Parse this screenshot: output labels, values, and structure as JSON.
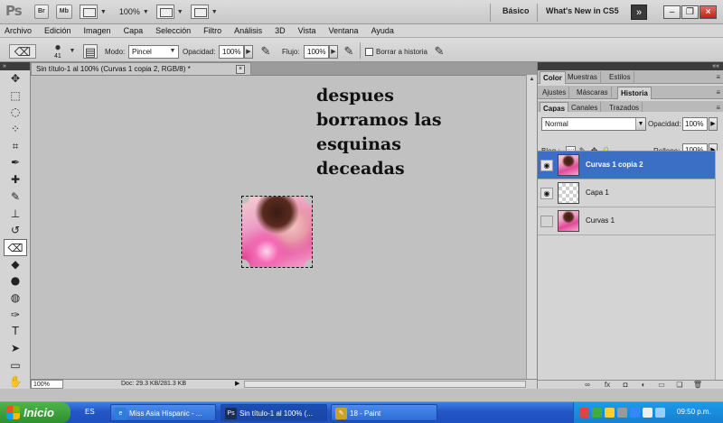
{
  "appbar": {
    "zoom": "100%",
    "workspace_basic": "Básico",
    "whats_new": "What's New in CS5",
    "bridge_label": "Br",
    "minibridge_label": "Mb"
  },
  "menu": [
    "Archivo",
    "Edición",
    "Imagen",
    "Capa",
    "Selección",
    "Filtro",
    "Análisis",
    "3D",
    "Vista",
    "Ventana",
    "Ayuda"
  ],
  "options": {
    "brush_size": "41",
    "mode_label": "Modo:",
    "mode_value": "Pincel",
    "opacity_label": "Opacidad:",
    "opacity_value": "100%",
    "flow_label": "Flujo:",
    "flow_value": "100%",
    "erase_history_label": "Borrar a historia"
  },
  "document": {
    "tab_title": "Sin título-1 al 100% (Curvas 1 copia 2, RGB/8) *",
    "annotation_lines": [
      "despues",
      "borramos las",
      "esquinas",
      "deceadas"
    ],
    "zoom_field": "100%",
    "doc_info": "Doc: 29.3 KB/281.3 KB"
  },
  "panels": {
    "row1_tabs": [
      "Color",
      "Muestras",
      "Estilos"
    ],
    "row2_tabs": [
      "Ajustes",
      "Máscaras",
      "Historia"
    ],
    "row3_tabs": [
      "Capas",
      "Canales",
      "Trazados"
    ],
    "blend_mode": "Normal",
    "opacity_label": "Opacidad:",
    "opacity_value": "100%",
    "lock_label": "Bloq.:",
    "fill_label": "Relleno:",
    "fill_value": "100%",
    "layers": [
      {
        "name": "Curvas 1 copia 2",
        "visible": true,
        "selected": true,
        "thumb": "photo"
      },
      {
        "name": "Capa 1",
        "visible": true,
        "selected": false,
        "thumb": "transparent"
      },
      {
        "name": "Curvas 1",
        "visible": false,
        "selected": false,
        "thumb": "photo"
      }
    ]
  },
  "taskbar": {
    "start_label": "Inicio",
    "language": "ES",
    "tasks": [
      "Miss Asia Hispanic - ...",
      "Sin título-1 al 100% (...",
      "18 - Paint"
    ],
    "clock": "09:50 p.m."
  },
  "colors": {
    "selected_layer": "#3b6fc6",
    "taskbar": "#2456c4",
    "start_button": "#3a9f38"
  }
}
